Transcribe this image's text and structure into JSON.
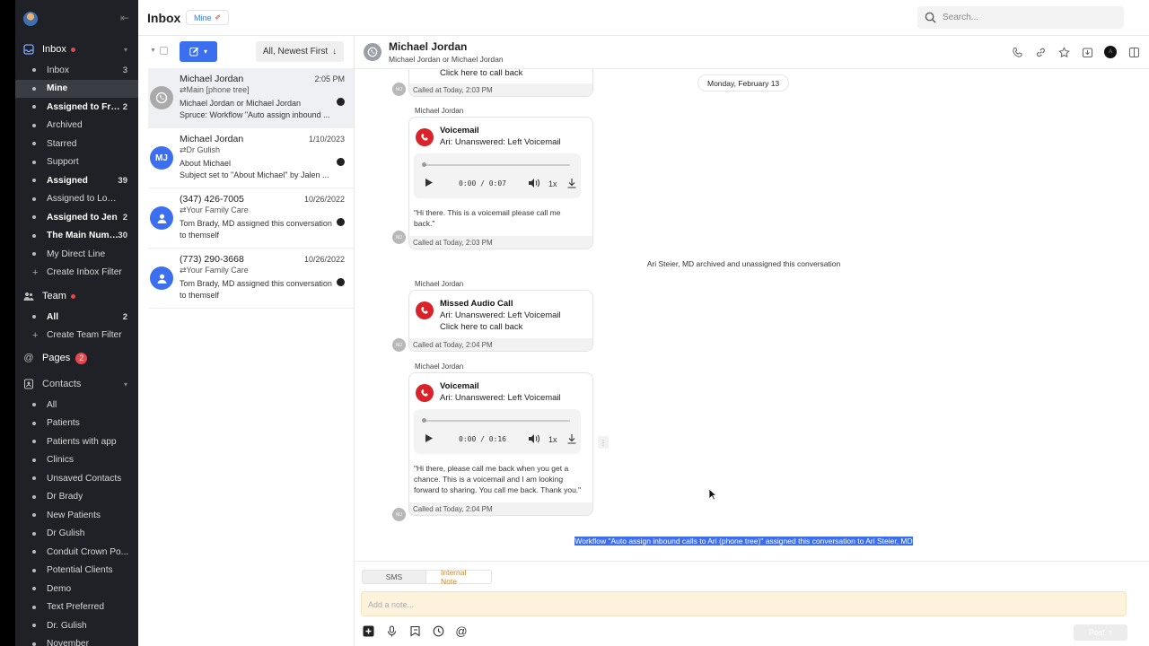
{
  "header": {
    "title": "Inbox",
    "mine_pill": "Mine",
    "search_placeholder": "Search..."
  },
  "sidebar": {
    "inbox_section": "Inbox",
    "inbox_items": [
      {
        "label": "Inbox",
        "count": "3"
      },
      {
        "label": "Mine",
        "count": ""
      },
      {
        "label": "Assigned to Fro...",
        "count": "2"
      },
      {
        "label": "Archived",
        "count": ""
      },
      {
        "label": "Starred",
        "count": ""
      },
      {
        "label": "Support",
        "count": ""
      },
      {
        "label": "Assigned",
        "count": "39"
      },
      {
        "label": "Assigned to Locati...",
        "count": ""
      },
      {
        "label": "Assigned to Jen",
        "count": "2"
      },
      {
        "label": "The Main Numb...",
        "count": "30"
      },
      {
        "label": "My Direct Line",
        "count": ""
      }
    ],
    "create_inbox_filter": "Create Inbox Filter",
    "team_section": "Team",
    "team_items": [
      {
        "label": "All",
        "count": "2"
      }
    ],
    "create_team_filter": "Create Team Filter",
    "pages_section": "Pages",
    "pages_count": "2",
    "contacts_section": "Contacts",
    "contact_items": [
      "All",
      "Patients",
      "Patients with app",
      "Clinics",
      "Unsaved Contacts",
      "Dr Brady",
      "New Patients",
      "Dr Gulish",
      "Conduit Crown Po...",
      "Potential Clients",
      "Demo",
      "Text Preferred",
      "Dr. Gulish",
      "November"
    ]
  },
  "list": {
    "sort_label": "All, Newest First",
    "conversations": [
      {
        "name": "Michael Jordan",
        "date": "2:05 PM",
        "sub": "Main [phone tree]",
        "preview": "Michael Jordan or Michael Jordan",
        "preview2": "Spruce: Workflow \"Auto assign inbound ...",
        "avatar": ""
      },
      {
        "name": "Michael Jordan",
        "date": "1/10/2023",
        "sub": "Dr Gulish",
        "preview": "About Michael",
        "preview2": "Subject set to \"About Michael\" by Jalen ...",
        "avatar": "MJ"
      },
      {
        "name": "(347) 426-7005",
        "date": "10/26/2022",
        "sub": "Your Family Care",
        "preview": "Tom Brady, MD assigned this conversation to themself",
        "preview2": "",
        "avatar": ""
      },
      {
        "name": "(773) 290-3668",
        "date": "10/26/2022",
        "sub": "Your Family Care",
        "preview": "Tom Brady, MD assigned this conversation to themself",
        "preview2": "",
        "avatar": ""
      }
    ]
  },
  "conversation": {
    "name": "Michael Jordan",
    "subtitle": "Michael Jordan or Michael Jordan",
    "account_badge": "A",
    "date_divider": "Monday, February 13",
    "top_card": {
      "line": "Click here to call back",
      "footer": "Called at Today, 2:03 PM"
    },
    "messages": [
      {
        "sender": "Michael Jordan",
        "title": "Voicemail",
        "line1": "Ari: Unanswered: Left Voicemail",
        "time": "0:00 / 0:07",
        "rate": "1x",
        "quote": "\"Hi there. This is a voicemail please call me back.\"",
        "footer": "Called at Today, 2:03 PM"
      },
      {
        "sender": "Michael Jordan",
        "title": "Missed Audio Call",
        "line1": "Ari: Unanswered: Left Voicemail",
        "line2": "Click here to call back",
        "footer": "Called at Today, 2:04 PM"
      },
      {
        "sender": "Michael Jordan",
        "title": "Voicemail",
        "line1": "Ari: Unanswered: Left Voicemail",
        "time": "0:00 / 0:16",
        "rate": "1x",
        "quote": "\"Hi there, please call me back when you get a chance. This is a voicemail and I am looking forward to sharing. You call me back. Thank you.\"",
        "footer": "Called at Today, 2:04 PM"
      }
    ],
    "avatar_initials": "MJ",
    "system_archived": "Ari Steier, MD archived and unassigned this conversation",
    "system_workflow": "Workflow \"Auto assign inbound calls to Ari (phone tree)\" assigned this conversation to Ari Steier, MD"
  },
  "composer": {
    "tab_sms": "SMS",
    "tab_note": "Internal Note",
    "placeholder": "Add a note...",
    "post_label": "Post"
  }
}
